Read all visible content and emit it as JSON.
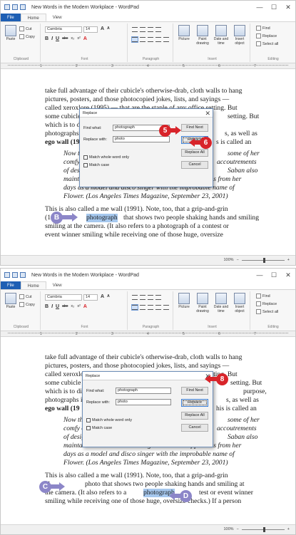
{
  "window": {
    "title": "New Words in the Modern Workplace - WordPad",
    "minimize_glyph": "—",
    "maximize_glyph": "☐",
    "close_glyph": "✕"
  },
  "tabs": {
    "file": "File",
    "home": "Home",
    "view": "View"
  },
  "ribbon": {
    "clipboard": {
      "paste": "Paste",
      "cut": "Cut",
      "copy": "Copy",
      "label": "Clipboard"
    },
    "font": {
      "family": "Cambria",
      "size": "14",
      "grow": "A",
      "shrink": "A",
      "bold": "B",
      "italic": "I",
      "underline": "U",
      "strike": "abe",
      "subscript": "x₂",
      "superscript": "x²",
      "label": "Font"
    },
    "paragraph": {
      "label": "Paragraph"
    },
    "insert": {
      "picture": "Picture",
      "paint": "Paint drawing",
      "datetime": "Date and time",
      "object": "Insert object",
      "label": "Insert"
    },
    "editing": {
      "find": "Find",
      "replace": "Replace",
      "select_all": "Select all",
      "label": "Editing"
    }
  },
  "ruler": {
    "marks": [
      "1",
      "2",
      "3",
      "4",
      "5",
      "6",
      "7"
    ]
  },
  "status": {
    "zoom": "100%",
    "minus": "−",
    "plus": "+"
  },
  "shot1": {
    "lines": [
      "take full advantage of their cubicle's otherwise-drab, cloth walls to hang",
      "pictures, posters, and those photocopied jokes, lists, and sayings —",
      "called xeroxlore (1995) — that are the staple of any office setting. But",
      "some cubicle",
      "which is to di",
      "photographs i",
      "ego wall (19"
    ],
    "lines_right": [
      "setting. But",
      "",
      "s, as well as",
      "s is called an"
    ],
    "quote": [
      "Now th",
      "comfy o",
      "of desig",
      "maintains what she calls her Ego Wall: rows of pictures from her",
      "days as a model and disco singer with the improbable name of",
      "Flower. (Los Angeles Times Magazine, September 23, 2001)"
    ],
    "quote_right": [
      "some of her",
      "accoutrements",
      "Saban also"
    ],
    "after": [
      "This is also called a me wall (1991). Note, too, that a grip-and-grin",
      "(1",
      "smiling at the camera. (It also refers to a photograph of a contest or",
      "event winner smiling while receiving one of those huge, oversize"
    ],
    "selected_word": "photograph",
    "after_rest": "that shows two people shaking hands and smiling",
    "dialog": {
      "title": "Replace",
      "find_label": "Find what:",
      "find_value": "photograph",
      "replace_label": "Replace with:",
      "replace_value": "photo",
      "find_next": "Find Next",
      "replace": "Replace",
      "replace_all": "Replace All",
      "cancel": "Cancel",
      "whole_word": "Match whole word only",
      "match_case": "Match case"
    },
    "callouts": {
      "c5": "5",
      "c6": "6",
      "cB": "B"
    }
  },
  "shot2": {
    "lines": [
      "take full advantage of their cubicle's otherwise-drab, cloth walls to hang",
      "pictures, posters, and those photocopied jokes, lists, and sayings —",
      "called xeroxlore (1995) — that are the staple of any office setting. But",
      "some cubicle",
      "which is to di",
      "photographs i",
      "ego wall (19"
    ],
    "lines_right": [
      "setting. But",
      "purpose,",
      "s, as well as",
      "his is called an"
    ],
    "quote": [
      "Now th",
      "comfy o",
      "of desig",
      "maintains what she calls her Ego Wall: rows of pictures from her",
      "days as a model and disco singer with the improbable name of",
      "Flower. (Los Angeles Times Magazine, September 23, 2001)"
    ],
    "quote_right": [
      "some of her",
      "accoutrements",
      "Saban also"
    ],
    "after": [
      "This is also called a me wall (1991). Note, too, that a grip-and-grin",
      "(1",
      "the camera. (It also refers to a",
      "smiling while receiving one of those huge, oversize checks.) If a person"
    ],
    "after_line2_rest": "photo that shows two people shaking hands and smiling at",
    "selected_word": "photograph",
    "after_line3_rest": "test or event winner",
    "dialog": {
      "title": "Replace",
      "find_label": "Find what:",
      "find_value": "photograph",
      "replace_label": "Replace with:",
      "replace_value": "photo",
      "find_next": "Find Next",
      "replace": "Replace",
      "replace_all": "Replace All",
      "cancel": "Cancel",
      "whole_word": "Match whole word only",
      "match_case": "Match case"
    },
    "callouts": {
      "c8": "8",
      "cC": "C",
      "cD": "D"
    }
  }
}
